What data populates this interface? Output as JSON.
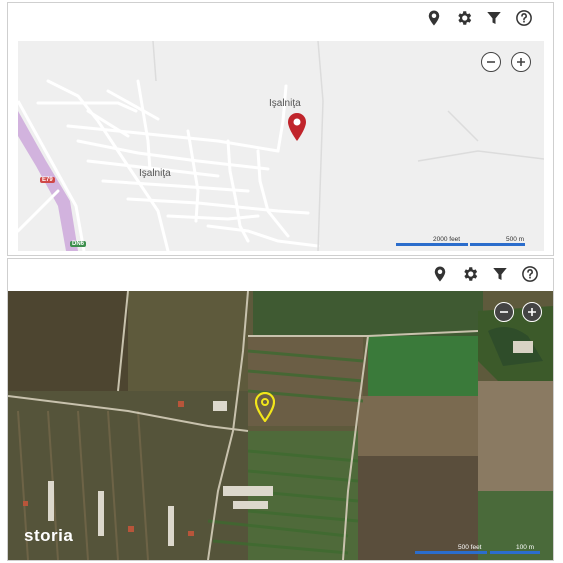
{
  "street_panel": {
    "toolbar": {
      "icons": [
        "location-pin-icon",
        "gear-icon",
        "filter-icon",
        "help-icon"
      ]
    },
    "zoom": {
      "out": "−",
      "in": "+"
    },
    "labels": {
      "town_north": "Işalniţa",
      "town_center": "Işalniţa",
      "road_e": "E79",
      "road_dn": "DN6"
    },
    "scale": {
      "feet": "2000 feet",
      "meters": "500 m"
    },
    "colors": {
      "marker": "#c0242b",
      "road": "#ffffff",
      "highway": "#c9a0d8",
      "background": "#efefef",
      "scale": "#2b6dcc"
    }
  },
  "satellite_panel": {
    "toolbar": {
      "icons": [
        "location-pin-icon",
        "gear-icon",
        "filter-icon",
        "help-icon"
      ]
    },
    "zoom": {
      "out": "−",
      "in": "+"
    },
    "watermark": "storia",
    "scale": {
      "feet": "500 feet",
      "meters": "100 m"
    },
    "colors": {
      "marker": "#f2e61a",
      "scale": "#2b6dcc"
    }
  }
}
